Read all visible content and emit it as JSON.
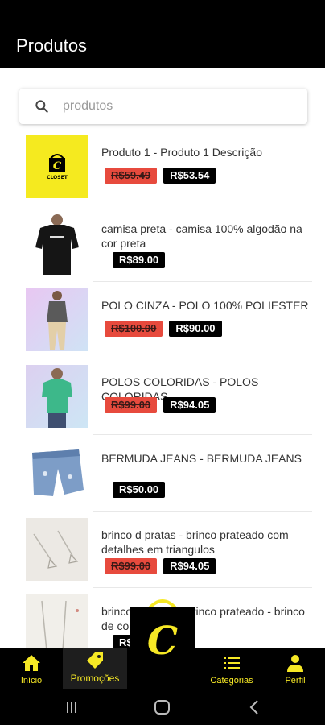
{
  "appbar": {
    "title": "Produtos"
  },
  "search": {
    "placeholder": "produtos"
  },
  "products": [
    {
      "title": "Produto 1 - Produto 1 Descrição",
      "old_price": "R$59.49",
      "price": "R$53.54"
    },
    {
      "title": "camisa preta - camisa 100% algodão na cor preta",
      "old_price": null,
      "price": "R$89.00"
    },
    {
      "title": "POLO CINZA - POLO 100% POLIESTER",
      "old_price": "R$100.00",
      "price": "R$90.00"
    },
    {
      "title": "POLOS COLORIDAS - POLOS COLORIDAS",
      "old_price": "R$99.00",
      "price": "R$94.05"
    },
    {
      "title": "BERMUDA JEANS - BERMUDA JEANS",
      "old_price": null,
      "price": "R$50.00"
    },
    {
      "title": "brinco d pratas - brinco prateado com detalhes em triangulos",
      "old_price": "R$99.00",
      "price": "R$94.05"
    },
    {
      "title": "brinco d pratas - brinco prateado - brinco de co... prateado",
      "old_price": null,
      "price": "R$..."
    }
  ],
  "brand": {
    "logo_text": "CLOSET",
    "accent": "#f6e825"
  },
  "bottom_nav": {
    "home": "Início",
    "promo": "Promoções",
    "categories": "Categorias",
    "profile": "Perfil"
  }
}
